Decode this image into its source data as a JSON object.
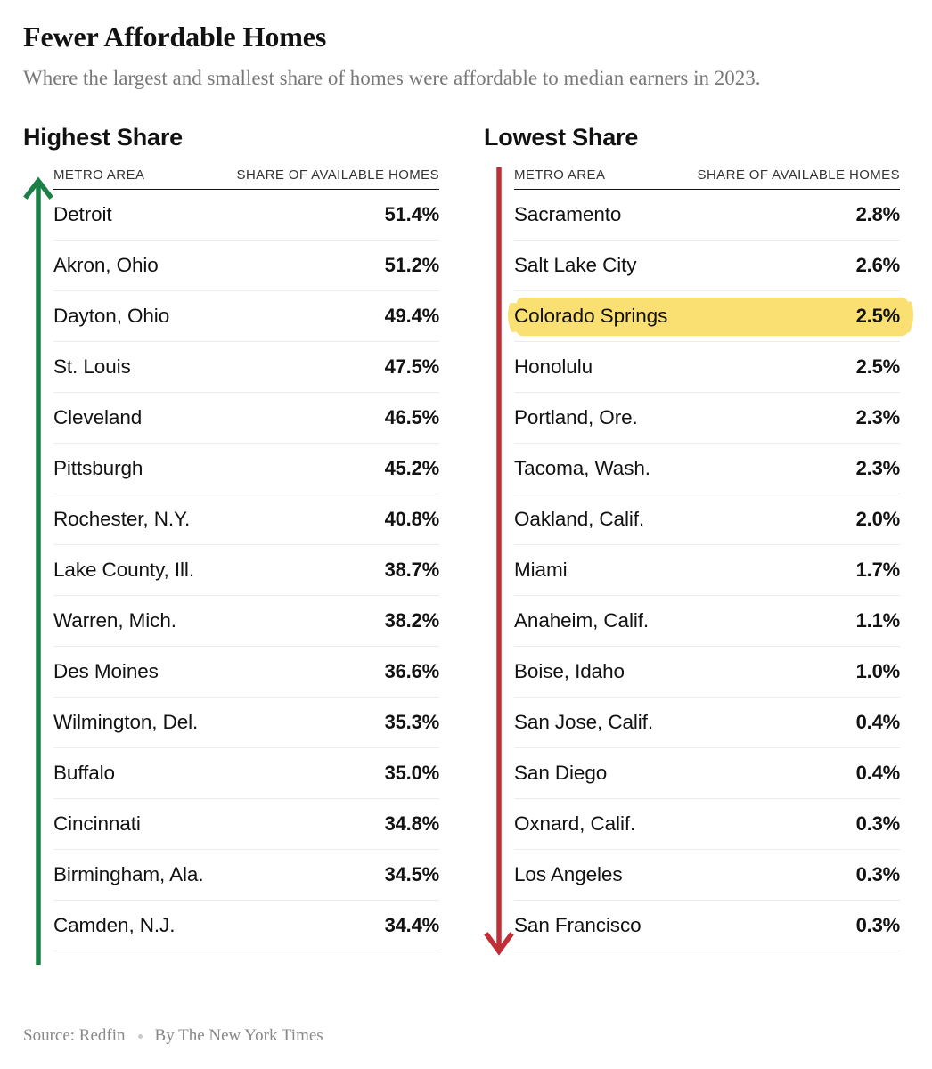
{
  "headline": "Fewer Affordable Homes",
  "subhead": "Where the largest and smallest share of homes were affordable to median earners in 2023.",
  "columns": {
    "left": {
      "title": "Highest Share",
      "rail_icon": "arrow-up-icon",
      "rail_color": "#1c8046",
      "headers": {
        "metro": "METRO AREA",
        "share": "SHARE OF AVAILABLE HOMES"
      }
    },
    "right": {
      "title": "Lowest Share",
      "rail_icon": "arrow-down-icon",
      "rail_color": "#bf2f38",
      "headers": {
        "metro": "METRO AREA",
        "share": "SHARE OF AVAILABLE HOMES"
      }
    }
  },
  "footer": {
    "source": "Source: Redfin",
    "credit": "By The New York Times"
  },
  "highlight_color": "#fadf72",
  "chart_data": {
    "type": "table",
    "title": "Fewer Affordable Homes",
    "subtitle": "Where the largest and smallest share of homes were affordable to median earners in 2023.",
    "source": "Redfin",
    "credit": "By The New York Times",
    "units": "percent of available homes affordable to median earners",
    "year": 2023,
    "tables": [
      {
        "name": "Highest Share",
        "columns": [
          "METRO AREA",
          "SHARE OF AVAILABLE HOMES"
        ],
        "rows": [
          {
            "metro": "Detroit",
            "share": "51.4%",
            "value": 51.4
          },
          {
            "metro": "Akron, Ohio",
            "share": "51.2%",
            "value": 51.2
          },
          {
            "metro": "Dayton, Ohio",
            "share": "49.4%",
            "value": 49.4
          },
          {
            "metro": "St. Louis",
            "share": "47.5%",
            "value": 47.5
          },
          {
            "metro": "Cleveland",
            "share": "46.5%",
            "value": 46.5
          },
          {
            "metro": "Pittsburgh",
            "share": "45.2%",
            "value": 45.2
          },
          {
            "metro": "Rochester, N.Y.",
            "share": "40.8%",
            "value": 40.8
          },
          {
            "metro": "Lake County, Ill.",
            "share": "38.7%",
            "value": 38.7
          },
          {
            "metro": "Warren, Mich.",
            "share": "38.2%",
            "value": 38.2
          },
          {
            "metro": "Des Moines",
            "share": "36.6%",
            "value": 36.6
          },
          {
            "metro": "Wilmington, Del.",
            "share": "35.3%",
            "value": 35.3
          },
          {
            "metro": "Buffalo",
            "share": "35.0%",
            "value": 35.0
          },
          {
            "metro": "Cincinnati",
            "share": "34.8%",
            "value": 34.8
          },
          {
            "metro": "Birmingham, Ala.",
            "share": "34.5%",
            "value": 34.5
          },
          {
            "metro": "Camden, N.J.",
            "share": "34.4%",
            "value": 34.4
          }
        ]
      },
      {
        "name": "Lowest Share",
        "columns": [
          "METRO AREA",
          "SHARE OF AVAILABLE HOMES"
        ],
        "rows": [
          {
            "metro": "Sacramento",
            "share": "2.8%",
            "value": 2.8
          },
          {
            "metro": "Salt Lake City",
            "share": "2.6%",
            "value": 2.6
          },
          {
            "metro": "Colorado Springs",
            "share": "2.5%",
            "value": 2.5,
            "highlighted": true
          },
          {
            "metro": "Honolulu",
            "share": "2.5%",
            "value": 2.5
          },
          {
            "metro": "Portland, Ore.",
            "share": "2.3%",
            "value": 2.3
          },
          {
            "metro": "Tacoma, Wash.",
            "share": "2.3%",
            "value": 2.3
          },
          {
            "metro": "Oakland, Calif.",
            "share": "2.0%",
            "value": 2.0
          },
          {
            "metro": "Miami",
            "share": "1.7%",
            "value": 1.7
          },
          {
            "metro": "Anaheim, Calif.",
            "share": "1.1%",
            "value": 1.1
          },
          {
            "metro": "Boise, Idaho",
            "share": "1.0%",
            "value": 1.0
          },
          {
            "metro": "San Jose, Calif.",
            "share": "0.4%",
            "value": 0.4
          },
          {
            "metro": "San Diego",
            "share": "0.4%",
            "value": 0.4
          },
          {
            "metro": "Oxnard, Calif.",
            "share": "0.3%",
            "value": 0.3
          },
          {
            "metro": "Los Angeles",
            "share": "0.3%",
            "value": 0.3
          },
          {
            "metro": "San Francisco",
            "share": "0.3%",
            "value": 0.3
          }
        ]
      }
    ]
  }
}
